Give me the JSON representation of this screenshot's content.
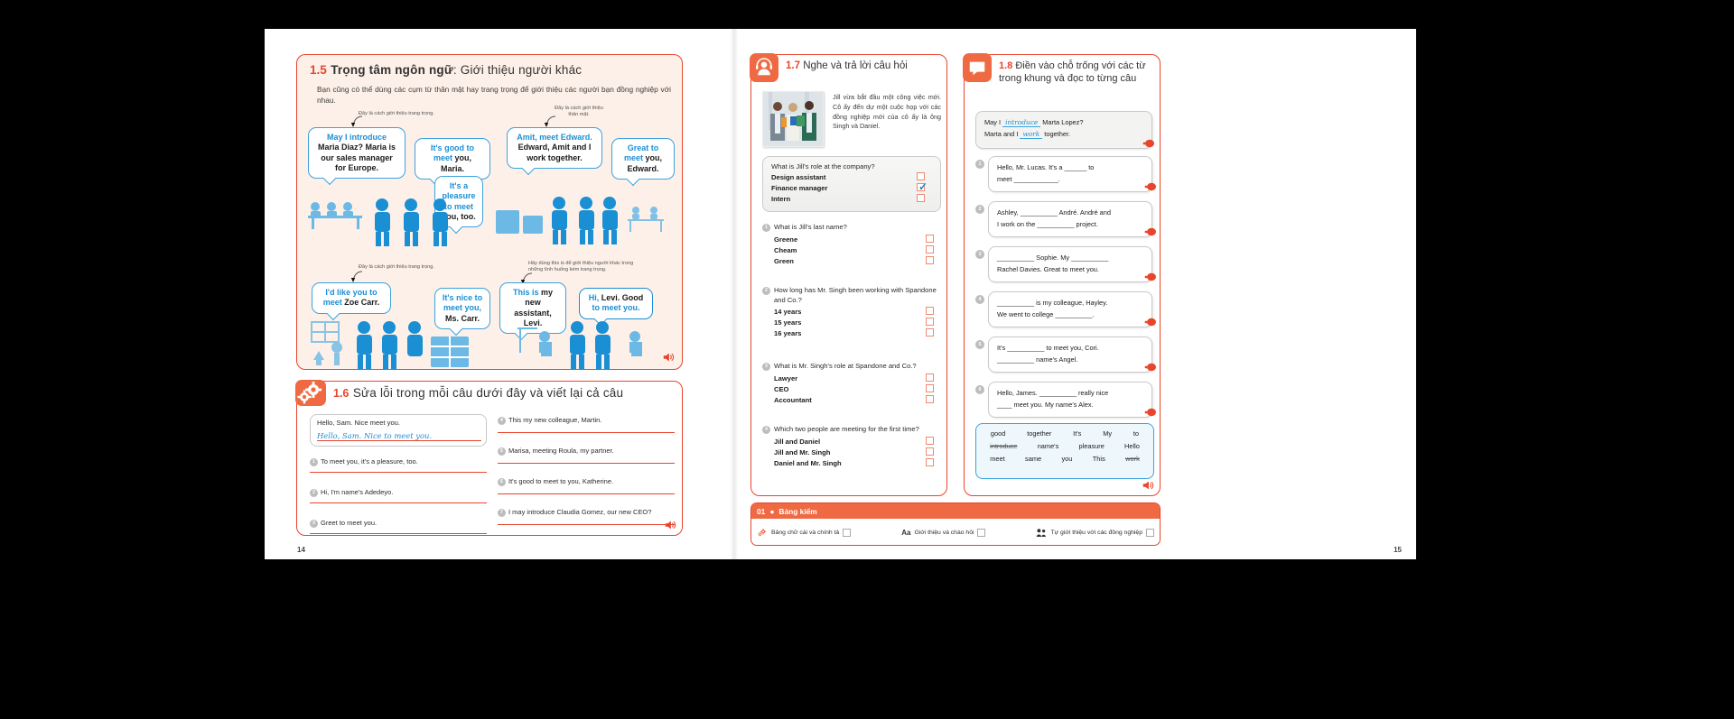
{
  "left_page": {
    "number": "14",
    "section_15": {
      "number": "1.5",
      "title_bold": "Trọng tâm ngôn ngữ",
      "title_rest": ": Giới thiệu người khác",
      "intro": "Bạn cũng có thể dùng các cụm từ thân mật hay trang trọng để giới thiệu các người bạn đồng nghiệp với nhau.",
      "note_formal_1": "Đây là cách giới thiệu trang trọng.",
      "note_informal": "Đây là cách giới thiệu thân mật.",
      "note_formal_2": "Đây là cách giới thiệu trang trọng.",
      "note_this_is": "Hãy dùng this is để giới thiệu người khác trong những tình huống kém trang trọng.",
      "bubbles": [
        {
          "blue": "May I introduce",
          "black": " Maria Diaz? Maria is our sales manager for Europe."
        },
        {
          "blue": "It's good to meet",
          "black": " you, Maria."
        },
        {
          "blue": "It's a pleasure to meet",
          "black": " you, too."
        },
        {
          "blue": "Amit, meet Edward.",
          "black": " Edward, Amit and I work together."
        },
        {
          "blue": "Great to meet",
          "black": " you, Edward."
        },
        {
          "blue": "I'd like you to meet",
          "black": " Zoe Carr."
        },
        {
          "blue": "It's nice to meet you,",
          "black": " Ms. Carr."
        },
        {
          "blue": "This is",
          "black": " my new assistant, Levi."
        },
        {
          "blue": "Hi,",
          "black": " Levi. Good",
          "blue2": " to meet you."
        }
      ]
    },
    "section_16": {
      "number": "1.6",
      "title": "Sửa lỗi trong mỗi câu dưới đây và viết lại cả câu",
      "sample_question": "Hello, Sam. Nice meet you.",
      "sample_answer": "Hello, Sam. Nice to meet you.",
      "items_left": [
        {
          "n": "1",
          "text": "To meet you, it's a pleasure, too."
        },
        {
          "n": "2",
          "text": "Hi, I'm name's Adedeyo."
        },
        {
          "n": "3",
          "text": "Greet to meet you."
        }
      ],
      "items_right": [
        {
          "n": "4",
          "text": "This my new colleague, Martin."
        },
        {
          "n": "5",
          "text": "Marisa, meeting Roula, my partner."
        },
        {
          "n": "6",
          "text": "It's good to meet to you, Katherine."
        },
        {
          "n": "7",
          "text": "I may introduce Claudia Gomez, our new CEO?"
        }
      ]
    }
  },
  "right_page": {
    "number": "15",
    "section_17": {
      "number": "1.7",
      "title": "Nghe và trả lời câu hỏi",
      "blurb": "Jill vừa bắt đầu một công việc mới. Cô ấy đến dự một cuộc họp với các đồng nghiệp mới của cô ấy là ông Singh và Daniel.",
      "example": {
        "question": "What is Jill's role at the company?",
        "options": [
          {
            "label": "Design assistant",
            "checked": false
          },
          {
            "label": "Finance manager",
            "checked": true
          },
          {
            "label": "Intern",
            "checked": false
          }
        ]
      },
      "questions": [
        {
          "n": "1",
          "text": "What is Jill's last name?",
          "options": [
            "Greene",
            "Cheam",
            "Green"
          ]
        },
        {
          "n": "2",
          "text": "How long has Mr. Singh been working with Spandone and Co.?",
          "options": [
            "14 years",
            "15 years",
            "16 years"
          ]
        },
        {
          "n": "3",
          "text": "What is Mr. Singh's role at Spandone and Co.?",
          "options": [
            "Lawyer",
            "CEO",
            "Accountant"
          ]
        },
        {
          "n": "4",
          "text": "Which two people are meeting for the first time?",
          "options": [
            "Jill and Daniel",
            "Jill and Mr. Singh",
            "Daniel and Mr. Singh"
          ]
        }
      ]
    },
    "section_18": {
      "number": "1.8",
      "title": "Điền vào chỗ trống với các từ trong khung và đọc to từng câu",
      "example": {
        "line1_pre": "May I ",
        "line1_ans": "introduce",
        "line1_post": " Marta Lopez?",
        "line2_pre": "Marta and I ",
        "line2_ans": "work",
        "line2_post": " together."
      },
      "items": [
        {
          "n": "1",
          "line1": "Hello, Mr. Lucas. It's a ______ to",
          "line2": "meet ____________."
        },
        {
          "n": "2",
          "line1": "Ashley, __________ André. André and",
          "line2": "I work on the __________ project."
        },
        {
          "n": "3",
          "line1": "__________ Sophie. My __________",
          "line2": "Rachel Davies. Great to meet you."
        },
        {
          "n": "4",
          "line1": "__________ is my colleague, Hayley.",
          "line2": "We went to college __________."
        },
        {
          "n": "5",
          "line1": "It's __________ to meet you, Cori.",
          "line2": "__________ name's Angel."
        },
        {
          "n": "6",
          "line1": "Hello, James. __________ really nice",
          "line2": "____ meet you. My name's Alex."
        }
      ],
      "word_bank": [
        {
          "w": "good",
          "used": false
        },
        {
          "w": "together",
          "used": false
        },
        {
          "w": "It's",
          "used": false
        },
        {
          "w": "My",
          "used": false
        },
        {
          "w": "to",
          "used": false
        },
        {
          "w": "introduce",
          "used": true
        },
        {
          "w": "name's",
          "used": false
        },
        {
          "w": "pleasure",
          "used": false
        },
        {
          "w": "Hello",
          "used": false
        },
        {
          "w": "meet",
          "used": false
        },
        {
          "w": "same",
          "used": false
        },
        {
          "w": "you",
          "used": false
        },
        {
          "w": "This",
          "used": false
        },
        {
          "w": "work",
          "used": true
        }
      ]
    },
    "checklist": {
      "number": "01",
      "title": "Bảng kiểm",
      "items": [
        {
          "icon": "gears-icon",
          "label": "Bảng chữ cái và chính tả"
        },
        {
          "icon": "aa-icon",
          "label": "Giới thiệu và chào hỏi"
        },
        {
          "icon": "people-icon",
          "label": "Tự giới thiệu với các đồng nghiệp"
        }
      ]
    }
  },
  "colors": {
    "accent_red": "#e8452c",
    "accent_orange": "#ef6a43",
    "accent_blue": "#1b8fd4",
    "panel_cream": "#fdf0e8"
  }
}
